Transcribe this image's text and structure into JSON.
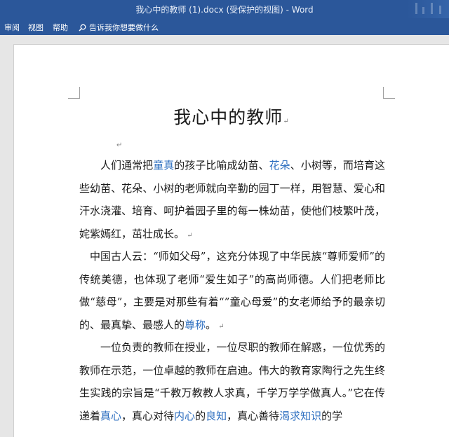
{
  "window": {
    "title": "我心中的教师 (1).docx (受保护的视图)  -  Word"
  },
  "menu": {
    "items": [
      "审阅",
      "视图",
      "帮助"
    ],
    "tell_me": "告诉我你想要做什么"
  },
  "document": {
    "title": "我心中的教师",
    "paragraph_mark": "↵",
    "paragraphs": [
      [
        {
          "t": "人们通常把",
          "hl": false
        },
        {
          "t": "童真",
          "hl": true
        },
        {
          "t": "的孩子比喻成幼苗、",
          "hl": false
        },
        {
          "t": "花朵",
          "hl": true
        },
        {
          "t": "、小树等，而培育这些幼苗、花朵、小树的老师就向辛勤的园丁一样，用智慧、爱心和汗水浇灌、培育、呵护着园子里的每一株幼苗，使他们枝繁叶茂，姹紫嫣红，茁壮成长。",
          "hl": false
        }
      ],
      [
        {
          "t": "中国古人云：“师如父母”，这充分体现了中华民族“尊师爱师”的传统美德，也体现了老师“爱生如子”的高尚师德。人们把老师比做“慈母”，主要是对那些有着“”童心母爱”的女老师给予的最亲切的、最真挚、最感人的",
          "hl": false
        },
        {
          "t": "尊称",
          "hl": true
        },
        {
          "t": "。",
          "hl": false
        }
      ],
      [
        {
          "t": "一位负责的教师在授业，一位尽职的教师在解惑，一位优秀的教师在示范，一位卓越的教师在启迪。伟大的教育家陶行之先生终生实践的宗旨是“千教万教教人求真，千学万学学做真人。”它在传递着",
          "hl": false
        },
        {
          "t": "真心",
          "hl": true
        },
        {
          "t": "，真心对待",
          "hl": false
        },
        {
          "t": "内心",
          "hl": true
        },
        {
          "t": "的",
          "hl": false
        },
        {
          "t": "良知",
          "hl": true
        },
        {
          "t": "，真心善待",
          "hl": false
        },
        {
          "t": "渴求知识",
          "hl": true
        },
        {
          "t": "的学",
          "hl": false
        }
      ]
    ]
  },
  "colors": {
    "ribbon": "#2b579a",
    "link_text": "#2e6fc0",
    "body_text": "#1a1a1a"
  }
}
